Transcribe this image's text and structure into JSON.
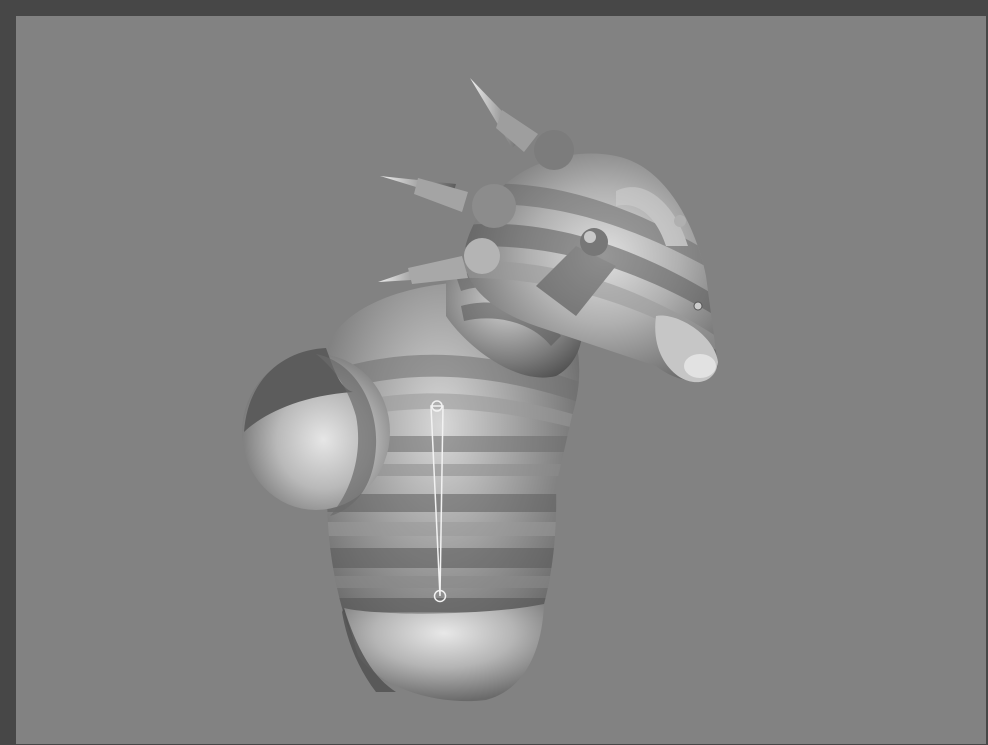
{
  "viewport": {
    "background": "#828282",
    "frame": "#474747"
  },
  "model": {
    "shading": "stepped-gray",
    "rig": {
      "joints": 2,
      "bones": 1
    }
  },
  "icons": [
    "bone-handle-icon",
    "joint-icon"
  ]
}
